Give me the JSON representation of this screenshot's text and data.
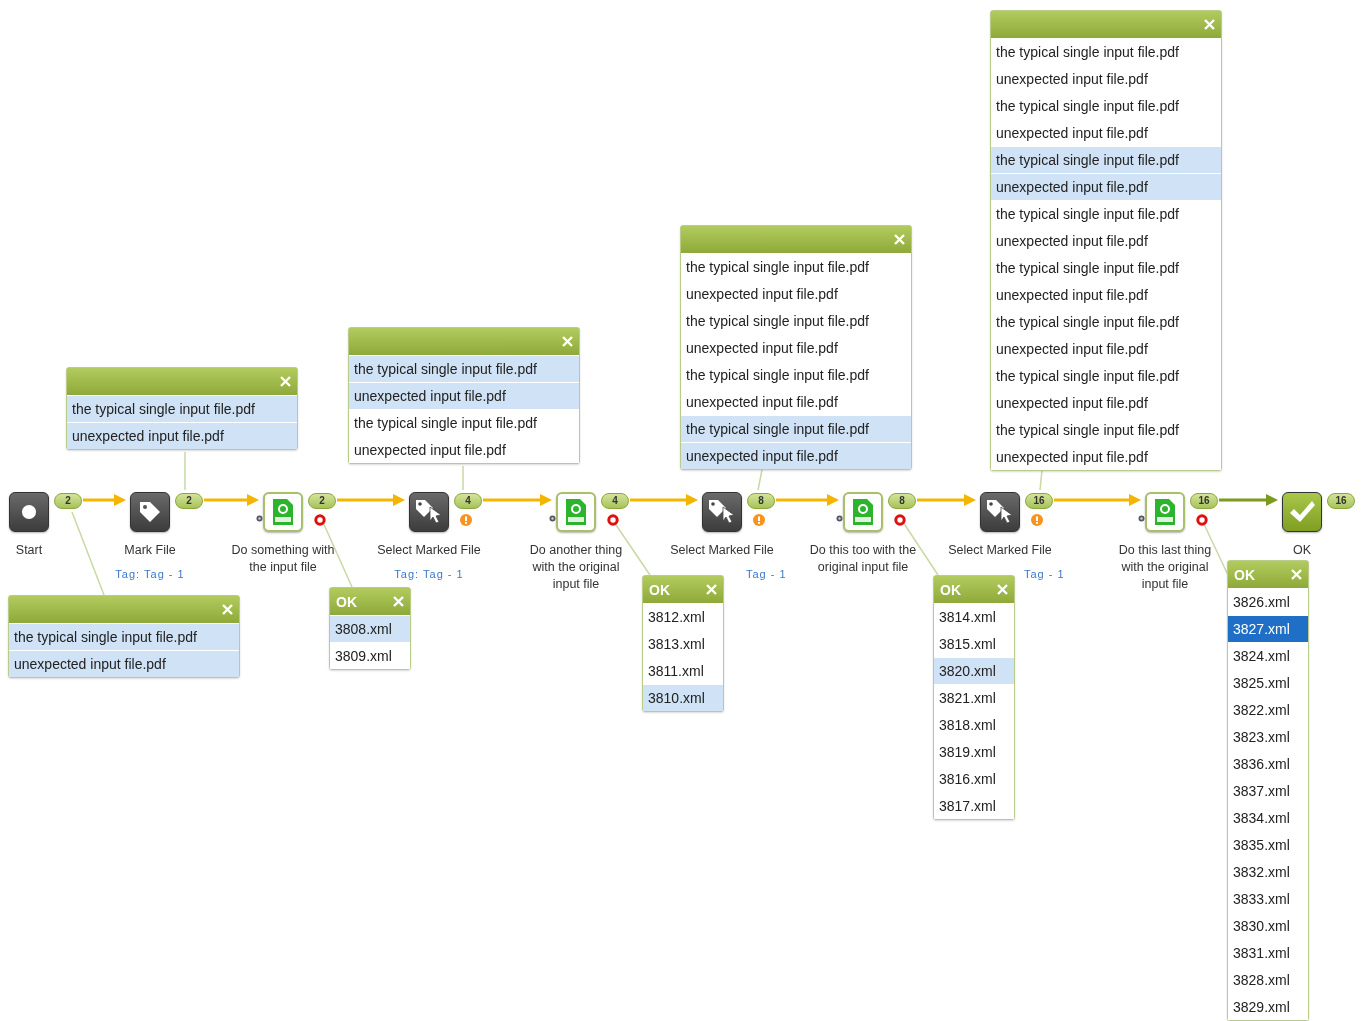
{
  "nodes": [
    {
      "label": "Start",
      "kind": "start",
      "badge": "2",
      "error": false,
      "warning": false
    },
    {
      "label": "Mark File",
      "kind": "tag",
      "tag": "Tag: Tag - 1",
      "badge": "2",
      "error": false,
      "warning": false
    },
    {
      "label": "Do something with the input file",
      "kind": "xml",
      "badge": "2",
      "error": true,
      "warning": false
    },
    {
      "label": "Select Marked File",
      "kind": "select",
      "tag": "Tag: Tag - 1",
      "badge": "4",
      "error": false,
      "warning": true
    },
    {
      "label": "Do another thing with the original input file",
      "kind": "xml",
      "badge": "4",
      "error": true,
      "warning": false
    },
    {
      "label": "Select Marked File",
      "kind": "select",
      "tag": "Tag - 1",
      "badge": "8",
      "error": false,
      "warning": true
    },
    {
      "label": "Do this too with the original input file",
      "kind": "xml",
      "badge": "8",
      "error": true,
      "warning": false
    },
    {
      "label": "Select Marked File",
      "kind": "select",
      "tag": "Tag - 1",
      "badge": "16",
      "error": false,
      "warning": true
    },
    {
      "label": "Do this last thing with the original input file",
      "kind": "xml",
      "badge": "16",
      "error": true,
      "warning": false
    },
    {
      "label": "OK",
      "kind": "ok",
      "badge": "16",
      "error": false,
      "warning": false
    }
  ],
  "popups": [
    {
      "rows": [
        {
          "text": "the typical single input file.pdf",
          "selected": true
        },
        {
          "text": "unexpected input file.pdf",
          "selected": true
        }
      ]
    },
    {
      "rows": [
        {
          "text": "the typical single input file.pdf",
          "selected": true
        },
        {
          "text": "unexpected input file.pdf",
          "selected": true
        }
      ]
    },
    {
      "rows": [
        {
          "text": "the typical single input file.pdf",
          "selected": true
        },
        {
          "text": "unexpected input file.pdf",
          "selected": true
        },
        {
          "text": "the typical single input file.pdf",
          "selected": false
        },
        {
          "text": "unexpected input file.pdf",
          "selected": false
        }
      ]
    },
    {
      "title": "OK",
      "rows": [
        {
          "text": "3808.xml",
          "selected": true
        },
        {
          "text": "3809.xml",
          "selected": false
        }
      ]
    },
    {
      "rows": [
        {
          "text": "the typical single input file.pdf",
          "selected": false
        },
        {
          "text": "unexpected input file.pdf",
          "selected": false
        },
        {
          "text": "the typical single input file.pdf",
          "selected": false
        },
        {
          "text": "unexpected input file.pdf",
          "selected": false
        },
        {
          "text": "the typical single input file.pdf",
          "selected": false
        },
        {
          "text": "unexpected input file.pdf",
          "selected": false
        },
        {
          "text": "the typical single input file.pdf",
          "selected": true
        },
        {
          "text": "unexpected input file.pdf",
          "selected": true
        }
      ]
    },
    {
      "title": "OK",
      "rows": [
        {
          "text": "3812.xml",
          "selected": false
        },
        {
          "text": "3813.xml",
          "selected": false
        },
        {
          "text": "3811.xml",
          "selected": false
        },
        {
          "text": "3810.xml",
          "selected": true
        }
      ]
    },
    {
      "rows": [
        {
          "text": "the typical single input file.pdf",
          "selected": false
        },
        {
          "text": "unexpected input file.pdf",
          "selected": false
        },
        {
          "text": "the typical single input file.pdf",
          "selected": false
        },
        {
          "text": "unexpected input file.pdf",
          "selected": false
        },
        {
          "text": "the typical single input file.pdf",
          "selected": true
        },
        {
          "text": "unexpected input file.pdf",
          "selected": true
        },
        {
          "text": "the typical single input file.pdf",
          "selected": false
        },
        {
          "text": "unexpected input file.pdf",
          "selected": false
        },
        {
          "text": "the typical single input file.pdf",
          "selected": false
        },
        {
          "text": "unexpected input file.pdf",
          "selected": false
        },
        {
          "text": "the typical single input file.pdf",
          "selected": false
        },
        {
          "text": "unexpected input file.pdf",
          "selected": false
        },
        {
          "text": "the typical single input file.pdf",
          "selected": false
        },
        {
          "text": "unexpected input file.pdf",
          "selected": false
        },
        {
          "text": "the typical single input file.pdf",
          "selected": false
        },
        {
          "text": "unexpected input file.pdf",
          "selected": false
        }
      ]
    },
    {
      "title": "OK",
      "rows": [
        {
          "text": "3814.xml",
          "selected": false
        },
        {
          "text": "3815.xml",
          "selected": false
        },
        {
          "text": "3820.xml",
          "selected": true
        },
        {
          "text": "3821.xml",
          "selected": false
        },
        {
          "text": "3818.xml",
          "selected": false
        },
        {
          "text": "3819.xml",
          "selected": false
        },
        {
          "text": "3816.xml",
          "selected": false
        },
        {
          "text": "3817.xml",
          "selected": false
        }
      ]
    },
    {
      "title": "OK",
      "rows": [
        {
          "text": "3826.xml",
          "selected": false,
          "focused": false
        },
        {
          "text": "3827.xml",
          "selected": true,
          "focused": true
        },
        {
          "text": "3824.xml",
          "selected": false,
          "focused": false
        },
        {
          "text": "3825.xml",
          "selected": false,
          "focused": false
        },
        {
          "text": "3822.xml",
          "selected": false,
          "focused": false
        },
        {
          "text": "3823.xml",
          "selected": false,
          "focused": false
        },
        {
          "text": "3836.xml",
          "selected": false,
          "focused": false
        },
        {
          "text": "3837.xml",
          "selected": false,
          "focused": false
        },
        {
          "text": "3834.xml",
          "selected": false,
          "focused": false
        },
        {
          "text": "3835.xml",
          "selected": false,
          "focused": false
        },
        {
          "text": "3832.xml",
          "selected": false,
          "focused": false
        },
        {
          "text": "3833.xml",
          "selected": false,
          "focused": false
        },
        {
          "text": "3830.xml",
          "selected": false,
          "focused": false
        },
        {
          "text": "3831.xml",
          "selected": false,
          "focused": false
        },
        {
          "text": "3828.xml",
          "selected": false,
          "focused": false
        },
        {
          "text": "3829.xml",
          "selected": false,
          "focused": false
        }
      ]
    }
  ]
}
